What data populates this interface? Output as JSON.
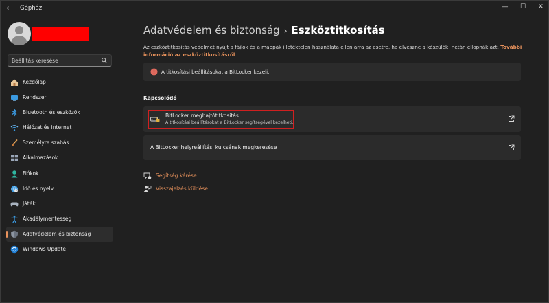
{
  "window": {
    "title": "Gépház",
    "controls": {
      "minimize": "—",
      "maximize": "☐",
      "close": "✕"
    }
  },
  "sidebar": {
    "search_placeholder": "Beállítás keresése",
    "items": [
      {
        "label": "Kezdőlap",
        "icon": "home-icon"
      },
      {
        "label": "Rendszer",
        "icon": "display-icon"
      },
      {
        "label": "Bluetooth és eszközök",
        "icon": "bluetooth-icon"
      },
      {
        "label": "Hálózat és internet",
        "icon": "wifi-icon"
      },
      {
        "label": "Személyre szabás",
        "icon": "brush-icon"
      },
      {
        "label": "Alkalmazások",
        "icon": "apps-icon"
      },
      {
        "label": "Fiókok",
        "icon": "account-icon"
      },
      {
        "label": "Idő és nyelv",
        "icon": "globe-clock-icon"
      },
      {
        "label": "Játék",
        "icon": "gamepad-icon"
      },
      {
        "label": "Akadálymentesség",
        "icon": "accessibility-icon"
      },
      {
        "label": "Adatvédelem és biztonság",
        "icon": "shield-icon",
        "active": true
      },
      {
        "label": "Windows Update",
        "icon": "update-icon"
      }
    ]
  },
  "breadcrumb": {
    "parent": "Adatvédelem és biztonság",
    "separator": "›",
    "current": "Eszköztitkosítás"
  },
  "description": {
    "text": "Az eszköztitkosítás védelmet nyújt a fájlok és a mappák illetéktelen használata ellen arra az esetre, ha elveszne a készülék, netán ellopnák azt.",
    "link": "További információ az eszköztitkosításról"
  },
  "infobar": {
    "text": "A titkosítási beállításokat a BitLocker kezeli."
  },
  "related": {
    "title": "Kapcsolódó",
    "card1": {
      "title": "BitLocker meghajtótitkosítás",
      "subtitle": "A titkosítási beállításokat a BitLocker segítségével kezelheti."
    },
    "card2": {
      "title": "A BitLocker helyreállítási kulcsának megkeresése"
    }
  },
  "help_links": {
    "help": "Segítség kérése",
    "feedback": "Visszajelzés küldése"
  },
  "colors": {
    "accent": "#e8925c",
    "background": "#202020",
    "card": "#2b2b2b",
    "warning": "#e06a5e",
    "highlight_border": "#d02020"
  }
}
